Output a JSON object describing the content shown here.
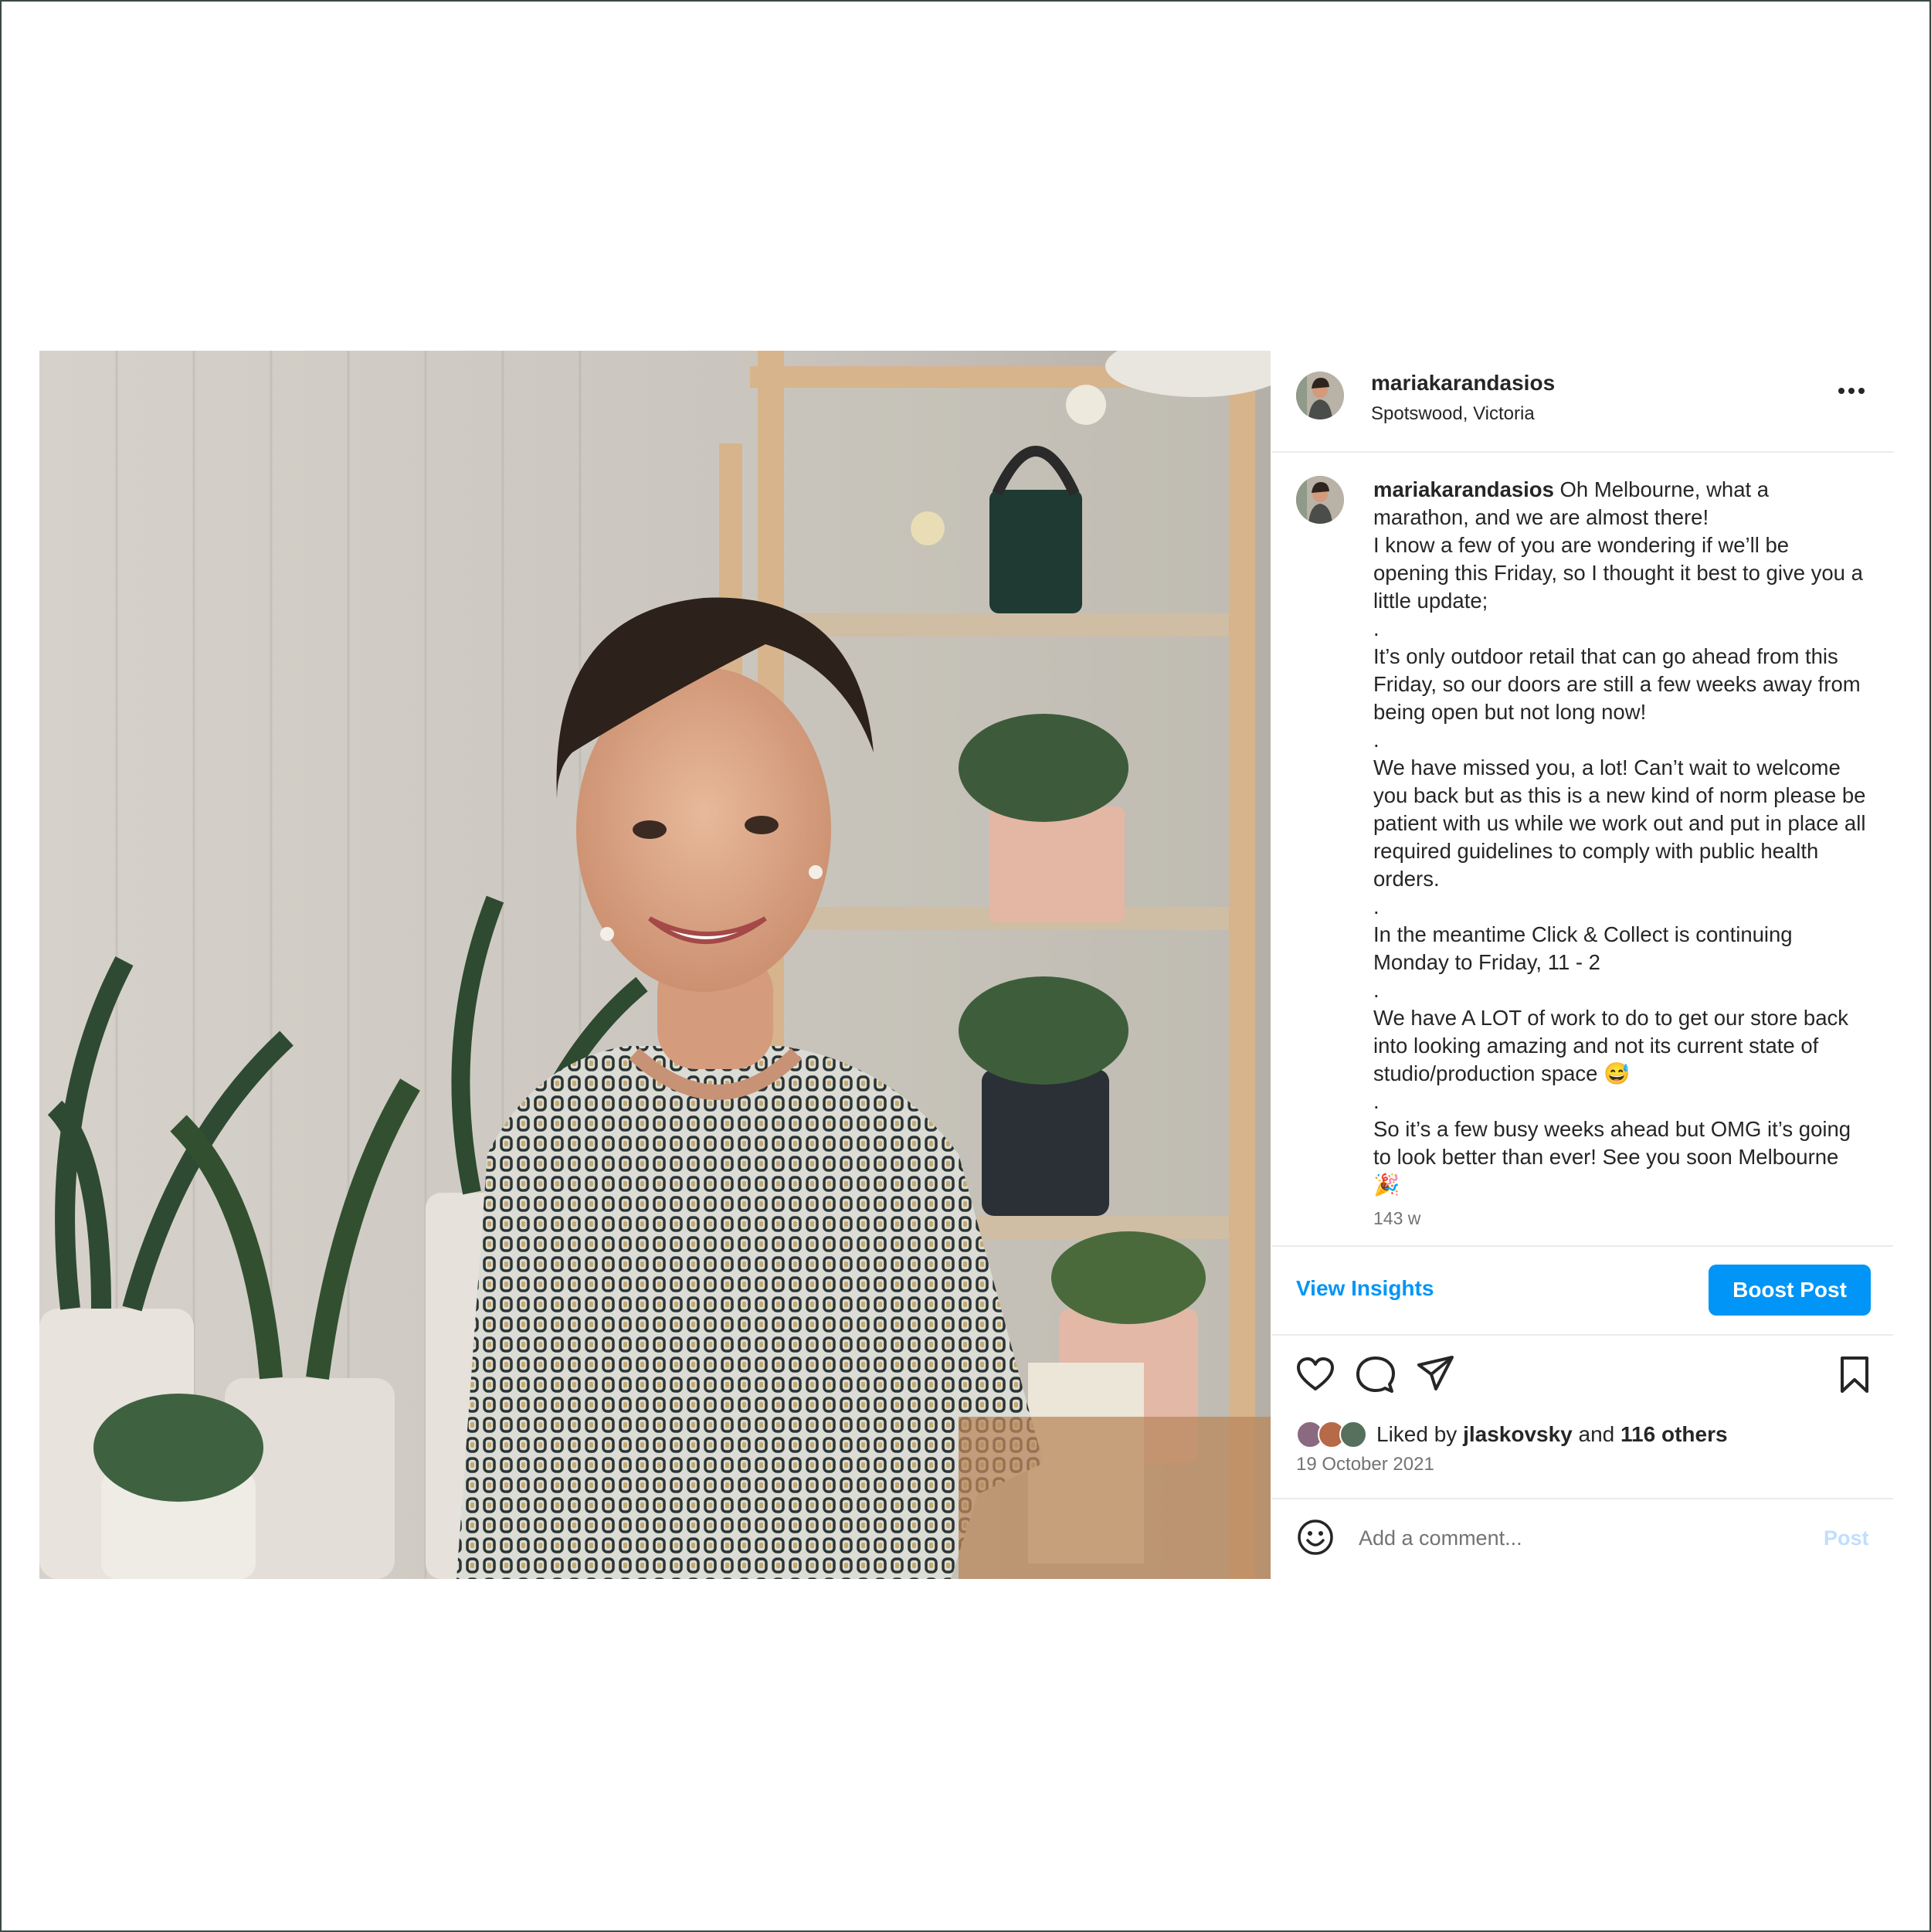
{
  "post": {
    "username": "mariakarandasios",
    "location": "Spotswood, Victoria",
    "caption": {
      "intro": "Oh Melbourne, what a marathon, and we are almost there!",
      "paragraphs": [
        "I know a few of you are wondering if we’ll be opening this Friday, so I thought it best to give you a little update;",
        ".",
        "It’s only outdoor retail that can go ahead from this Friday, so our doors are still a few weeks away from being open but not long now!",
        ".",
        "We have missed you, a lot! Can’t wait to welcome you back but as this is a new kind of norm please be patient with us while we work out and put in place all required guidelines to comply with public health orders.",
        ".",
        "In the meantime Click & Collect is continuing Monday to Friday, 11 - 2",
        ".",
        "We have A LOT of work to do to get our store back into looking amazing and not its current state of studio/production space 😅",
        ".",
        "So it’s a few busy weeks ahead but OMG it’s going to look better than ever! See you soon Melbourne 🎉"
      ],
      "time_ago": "143 w"
    },
    "actions": {
      "view_insights": "View Insights",
      "boost_post": "Boost Post"
    },
    "likes": {
      "prefix": "Liked by",
      "user": "jlaskovsky",
      "joiner": "and",
      "others": "116 others"
    },
    "date": "19 October 2021",
    "comment": {
      "placeholder": "Add a comment...",
      "post_label": "Post"
    }
  },
  "icons": {
    "more": "more-options-icon",
    "like": "heart-icon",
    "comment": "comment-bubble-icon",
    "share": "paper-plane-icon",
    "save": "bookmark-icon",
    "emoji": "smiley-icon"
  },
  "colors": {
    "accent": "#0095f6",
    "post_disabled": "#c0dffd",
    "secondary_text": "#737373"
  }
}
